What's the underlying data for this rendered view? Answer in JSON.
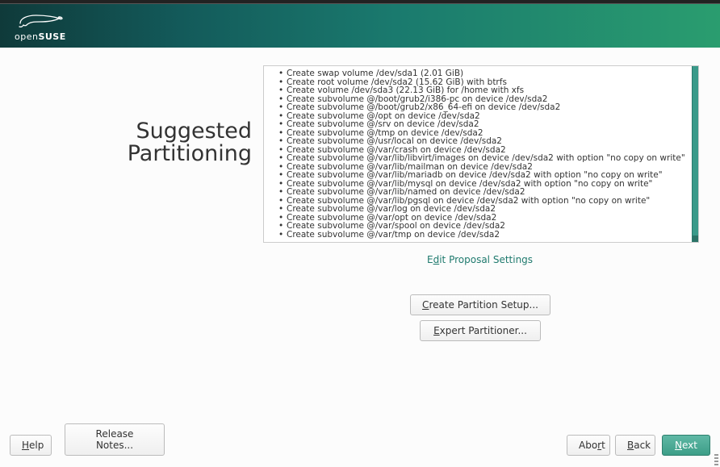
{
  "brand": {
    "name_html": "openSUSE"
  },
  "heading": {
    "line1": "Suggested",
    "line2": "Partitioning"
  },
  "proposal_items": [
    "Create swap volume /dev/sda1 (2.01 GiB)",
    "Create root volume /dev/sda2 (15.62 GiB) with btrfs",
    "Create volume /dev/sda3 (22.13 GiB) for /home with xfs",
    "Create subvolume @/boot/grub2/i386-pc on device /dev/sda2",
    "Create subvolume @/boot/grub2/x86_64-efi on device /dev/sda2",
    "Create subvolume @/opt on device /dev/sda2",
    "Create subvolume @/srv on device /dev/sda2",
    "Create subvolume @/tmp on device /dev/sda2",
    "Create subvolume @/usr/local on device /dev/sda2",
    "Create subvolume @/var/crash on device /dev/sda2",
    "Create subvolume @/var/lib/libvirt/images on device /dev/sda2 with option \"no copy on write\"",
    "Create subvolume @/var/lib/mailman on device /dev/sda2",
    "Create subvolume @/var/lib/mariadb on device /dev/sda2 with option \"no copy on write\"",
    "Create subvolume @/var/lib/mysql on device /dev/sda2 with option \"no copy on write\"",
    "Create subvolume @/var/lib/named on device /dev/sda2",
    "Create subvolume @/var/lib/pgsql on device /dev/sda2 with option \"no copy on write\"",
    "Create subvolume @/var/log on device /dev/sda2",
    "Create subvolume @/var/opt on device /dev/sda2",
    "Create subvolume @/var/spool on device /dev/sda2",
    "Create subvolume @/var/tmp on device /dev/sda2"
  ],
  "buttons": {
    "edit_proposal_pre": "E",
    "edit_proposal_accel": "d",
    "edit_proposal_post": "it Proposal Settings",
    "create_partition_accel": "C",
    "create_partition_post": "reate Partition Setup...",
    "expert_accel": "E",
    "expert_post": "xpert Partitioner...",
    "help_accel": "H",
    "help_post": "elp",
    "release_notes": "Release Notes...",
    "abort_pre": "Abo",
    "abort_accel": "r",
    "abort_post": "t",
    "back_accel": "B",
    "back_post": "ack",
    "next_accel": "N",
    "next_post": "ext"
  }
}
